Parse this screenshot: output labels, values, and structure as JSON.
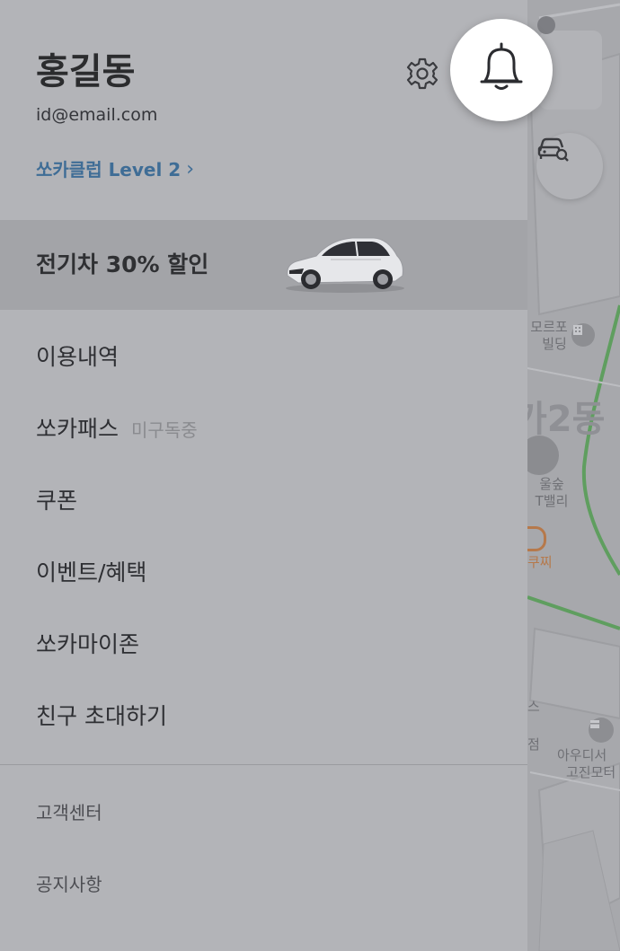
{
  "user": {
    "name": "홍길동",
    "email": "id@email.com",
    "club_link": "쏘카클럽 Level 2",
    "club_chevron": "›"
  },
  "promo": {
    "text": "전기차 30% 할인"
  },
  "menu": {
    "items": [
      {
        "label": "이용내역",
        "sub": ""
      },
      {
        "label": "쏘카패스",
        "sub": "미구독중"
      },
      {
        "label": "쿠폰",
        "sub": ""
      },
      {
        "label": "이벤트/혜택",
        "sub": ""
      },
      {
        "label": "쏘카마이존",
        "sub": ""
      },
      {
        "label": "친구 초대하기",
        "sub": ""
      }
    ],
    "secondary": [
      {
        "label": "고객센터"
      },
      {
        "label": "공지사항"
      }
    ]
  },
  "map": {
    "labels": {
      "building_a_1": "모르포",
      "building_a_2": "빌딩",
      "district": "가2동",
      "forest_1": "울숲",
      "forest_2": "T밸리",
      "shop": "쿠찌",
      "s_char": "스",
      "jeom": "점",
      "audi_1": "아우디서",
      "audi_2": "고진모터"
    }
  },
  "icons": {
    "settings": "gear-icon",
    "bell": "bell-icon",
    "car_search": "car-search-icon",
    "building": "building-icon",
    "shop": "shop-icon"
  },
  "colors": {
    "drawer_bg": "#b3b4b8",
    "promo_bg": "#a3a4a8",
    "link": "#3f6d96",
    "map_road_green": "#5f9e5f"
  }
}
